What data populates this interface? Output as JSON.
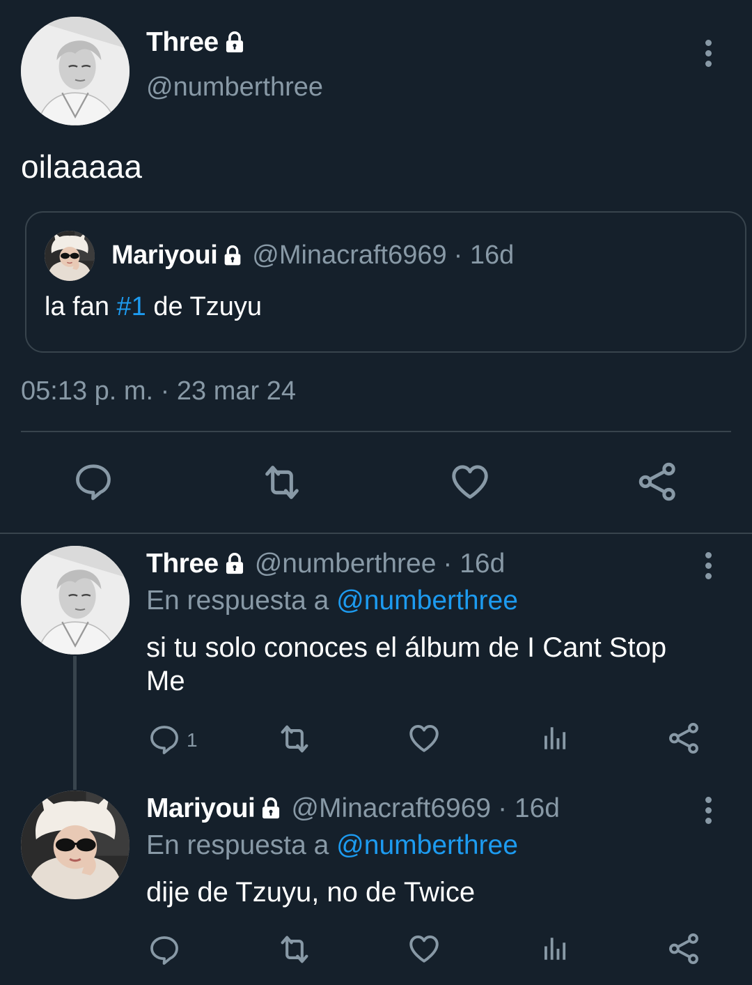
{
  "main_tweet": {
    "author_name": "Three",
    "author_handle": "@numberthree",
    "text": "oilaaaaa",
    "quoted": {
      "author_name": "Mariyoui",
      "author_handle": "@Minacraft6969",
      "time_ago": "· 16d",
      "text_before": "la fan ",
      "hashtag": "#1",
      "text_after": " de Tzuyu"
    },
    "timestamp": "05:13 p. m. · 23 mar 24"
  },
  "replies": [
    {
      "author_name": "Three",
      "author_handle": "@numberthree",
      "time_ago": "· 16d",
      "reply_prefix": "En respuesta a ",
      "reply_to": "@numberthree",
      "text": "si tu solo conoces el álbum de I Cant Stop Me",
      "reply_count": "1"
    },
    {
      "author_name": "Mariyoui",
      "author_handle": "@Minacraft6969",
      "time_ago": "· 16d",
      "reply_prefix": "En respuesta a ",
      "reply_to": "@numberthree",
      "text": "dije de Tzuyu, no de Twice",
      "reply_count": ""
    }
  ],
  "icons": [
    "lock-icon",
    "more-options-icon",
    "reply-icon",
    "retweet-icon",
    "like-icon",
    "share-icon",
    "analytics-icon"
  ],
  "colors": {
    "background": "#15202b",
    "accent": "#1d9bf0",
    "muted": "#8899a6",
    "divider": "#38444d"
  }
}
